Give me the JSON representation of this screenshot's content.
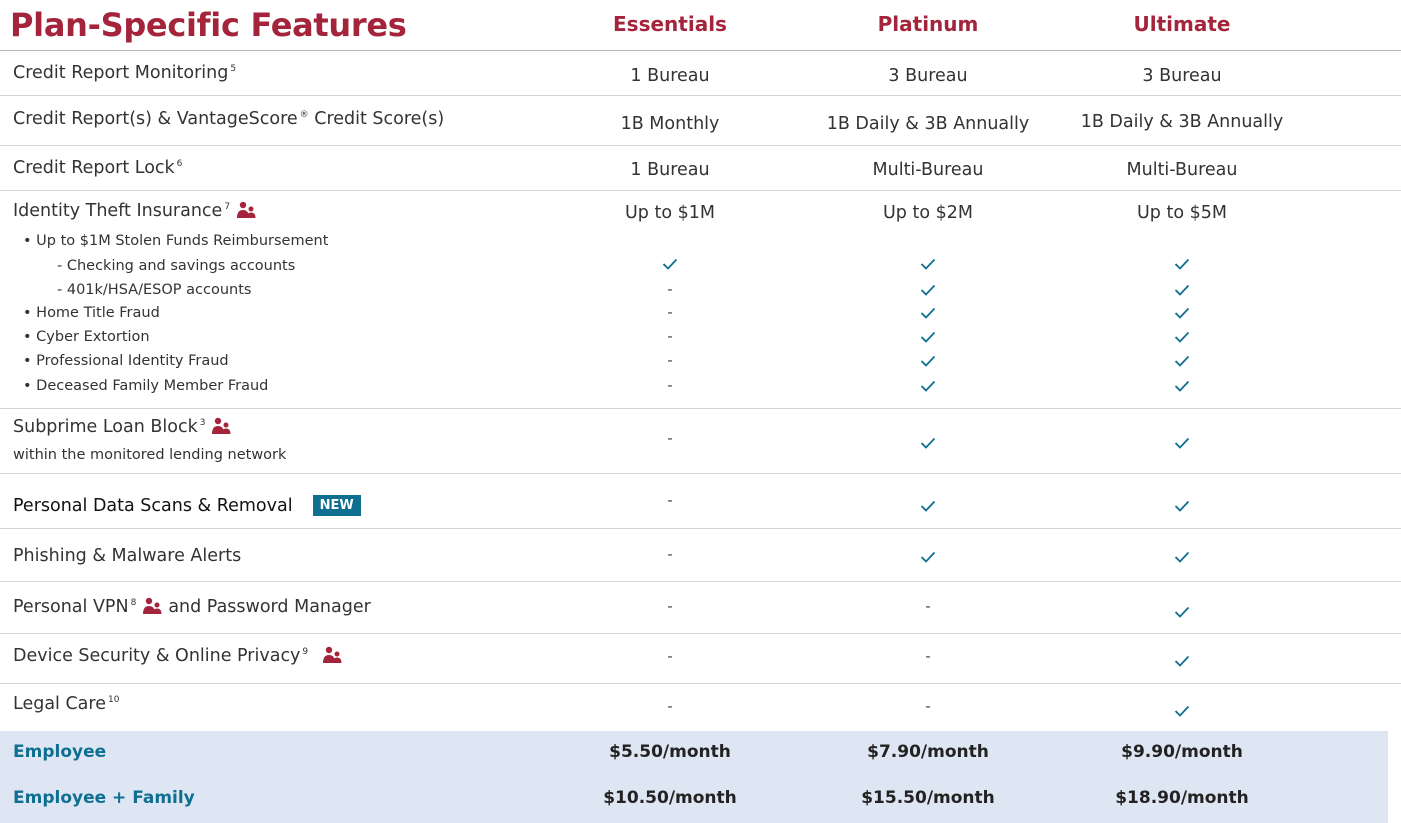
{
  "header": {
    "title": "Plan-Specific Features",
    "plans": [
      "Essentials",
      "Platinum",
      "Ultimate"
    ]
  },
  "rows": [
    {
      "label": "Credit Report Monitoring",
      "sup": "5",
      "values": [
        "1 Bureau",
        "3 Bureau",
        "3 Bureau"
      ]
    },
    {
      "label": "Credit Report(s) & VantageScore",
      "sup_mark": "®",
      "label_tail": " Credit Score(s)",
      "values": [
        "1B Monthly",
        "1B Daily & 3B Annually",
        "1B Daily & 3B Annually"
      ]
    },
    {
      "label": "Credit Report Lock",
      "sup": "6",
      "values": [
        "1 Bureau",
        "Multi-Bureau",
        "Multi-Bureau"
      ]
    },
    {
      "label": "Identity Theft Insurance",
      "sup": "7",
      "values": [
        "Up to $1M",
        "Up to $2M",
        "Up to $5M"
      ]
    }
  ],
  "insurance_details": [
    {
      "label": "• Up to $1M Stolen Funds Reimbursement",
      "values": [
        "",
        "",
        ""
      ]
    },
    {
      "label": "- Checking and savings accounts",
      "values": [
        "check",
        "check",
        "check"
      ]
    },
    {
      "label": "- 401k/HSA/ESOP accounts",
      "values": [
        "-",
        "check",
        "check"
      ]
    },
    {
      "label": "• Home Title Fraud",
      "values": [
        "-",
        "check",
        "check"
      ]
    },
    {
      "label": "• Cyber Extortion",
      "values": [
        "-",
        "check",
        "check"
      ]
    },
    {
      "label": "• Professional Identity Fraud",
      "values": [
        "-",
        "check",
        "check"
      ]
    },
    {
      "label": "• Deceased Family Member Fraud",
      "values": [
        "-",
        "check",
        "check"
      ]
    }
  ],
  "features": {
    "subprime": {
      "label": "Subprime Loan Block",
      "sup": "3",
      "sublabel": "within the monitored lending network",
      "values": [
        "-",
        "check",
        "check"
      ]
    },
    "data_scans": {
      "label": "Personal Data Scans & Removal",
      "badge": "NEW",
      "values": [
        "-",
        "check",
        "check"
      ]
    },
    "phishing": {
      "label": "Phishing & Malware Alerts",
      "values": [
        "-",
        "check",
        "check"
      ]
    },
    "vpn": {
      "label": "Personal VPN",
      "sup": "8",
      "label_tail": "and Password Manager",
      "values": [
        "-",
        "-",
        "check"
      ]
    },
    "device": {
      "label": "Device Security & Online Privacy",
      "sup": "9",
      "values": [
        "-",
        "-",
        "check"
      ]
    },
    "legal": {
      "label": "Legal Care",
      "sup": "10",
      "values": [
        "-",
        "-",
        "check"
      ]
    }
  },
  "pricing": [
    {
      "label": "Employee",
      "values": [
        "$5.50/month",
        "$7.90/month",
        "$9.90/month"
      ]
    },
    {
      "label": "Employee + Family",
      "values": [
        "$10.50/month",
        "$15.50/month",
        "$18.90/month"
      ]
    }
  ],
  "colors": {
    "accent": "#a4243b",
    "link": "#0e6f91",
    "check": "#0e6f91",
    "footer_bg": "#dde6f2"
  },
  "icons": {
    "family": "family-icon",
    "check": "check-icon"
  }
}
